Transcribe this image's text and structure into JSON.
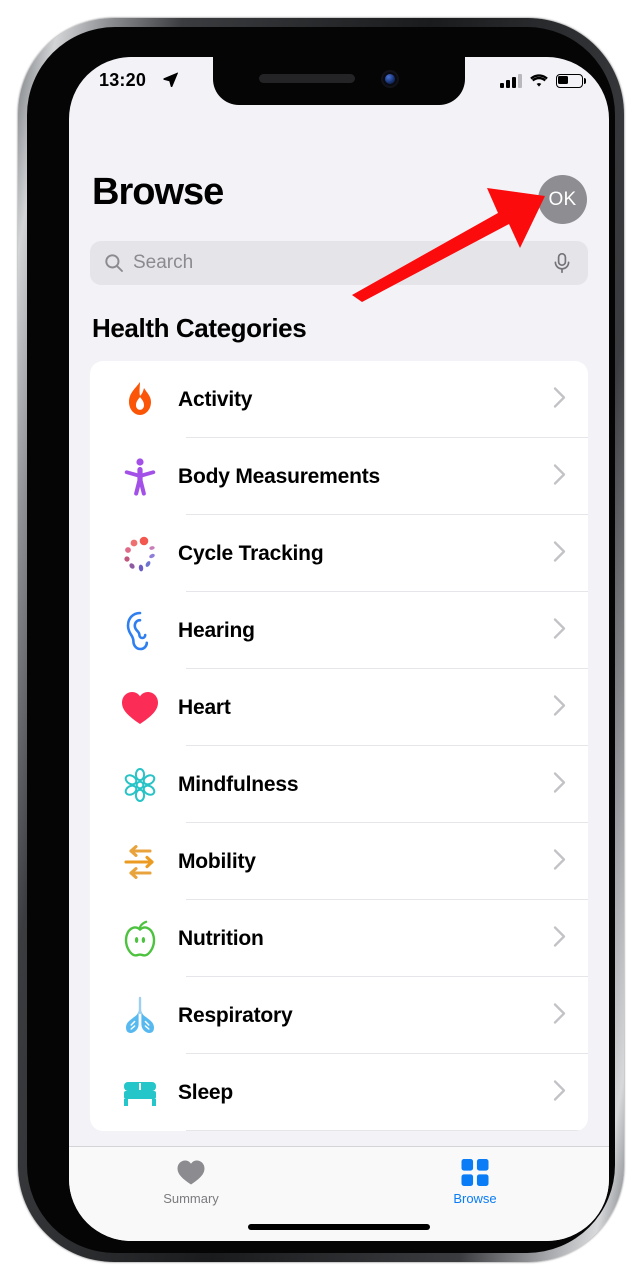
{
  "device": {
    "frame": "iphone-x",
    "screen_bg": "#f2f2f7"
  },
  "status_bar": {
    "time": "13:20",
    "location_icon": "location-arrow-icon",
    "cellular_icon": "cellular-bars-icon",
    "cellular_bars": 3,
    "wifi_icon": "wifi-icon",
    "battery_icon": "battery-icon",
    "battery_level_pct": 42
  },
  "header": {
    "title": "Browse",
    "profile": {
      "initials": "OK",
      "bg_color": "#8d8d92",
      "name": "profile-avatar"
    }
  },
  "search": {
    "placeholder": "Search",
    "value": "",
    "search_icon": "search-icon",
    "mic_icon": "microphone-icon"
  },
  "main": {
    "section_title": "Health Categories",
    "categories": [
      {
        "label": "Activity",
        "icon": "flame-icon",
        "color": "#fb5607"
      },
      {
        "label": "Body Measurements",
        "icon": "person-icon",
        "color": "#a350e8"
      },
      {
        "label": "Cycle Tracking",
        "icon": "cycle-icon",
        "color": "#f2584f"
      },
      {
        "label": "Hearing",
        "icon": "ear-icon",
        "color": "#2f7ff0"
      },
      {
        "label": "Heart",
        "icon": "heart-icon",
        "color": "#fb2c55"
      },
      {
        "label": "Mindfulness",
        "icon": "mandala-icon",
        "color": "#27c3c6"
      },
      {
        "label": "Mobility",
        "icon": "arrows-icon",
        "color": "#e8a33d"
      },
      {
        "label": "Nutrition",
        "icon": "apple-icon",
        "color": "#4cc23f"
      },
      {
        "label": "Respiratory",
        "icon": "lungs-icon",
        "color": "#57b9f0"
      },
      {
        "label": "Sleep",
        "icon": "bed-icon",
        "color": "#24c6c9"
      }
    ],
    "chevron_icon": "chevron-right-icon"
  },
  "tab_bar": {
    "tabs": [
      {
        "label": "Summary",
        "icon": "heart-icon",
        "active": false,
        "color": "#7c7c80"
      },
      {
        "label": "Browse",
        "icon": "grid-squares-icon",
        "active": true,
        "color": "#0a7cf6"
      }
    ]
  },
  "annotation": {
    "arrow_color": "#fb0b0b",
    "points_to": "profile-avatar"
  }
}
